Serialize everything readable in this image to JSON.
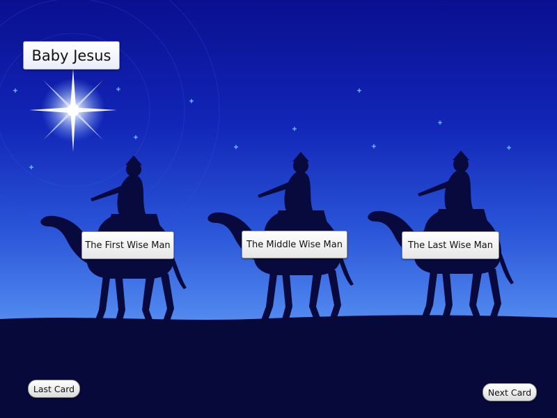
{
  "title": "Baby Jesus",
  "wise_men": [
    {
      "label": "The First Wise Man"
    },
    {
      "label": "The Middle Wise Man"
    },
    {
      "label": "The Last Wise Man"
    }
  ],
  "nav": {
    "last_card": "Last Card",
    "next_card": "Next Card"
  },
  "scene": {
    "sky_top_color": "#0a0f8f",
    "sky_bottom_color": "#6aa0f2",
    "ground_color": "#06093a",
    "star_color": "#7fe7ff"
  }
}
